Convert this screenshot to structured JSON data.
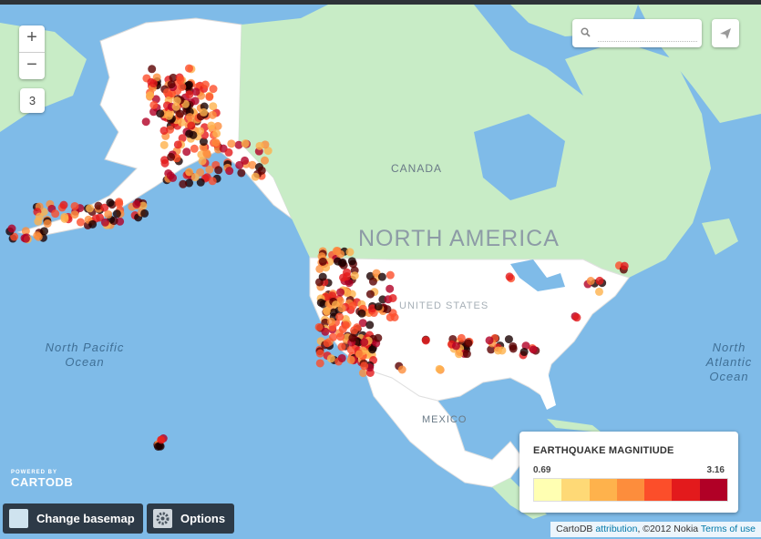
{
  "map": {
    "labels": {
      "canada": "CANADA",
      "north_america": "NORTH AMERICA",
      "united_states": "UNITED STATES",
      "mexico": "MEXICO",
      "north_pacific_ocean": "North Pacific Ocean",
      "north_atlantic": "North Atlantic Ocean"
    },
    "zoom_level": "3"
  },
  "controls": {
    "zoom_in": "+",
    "zoom_out": "−",
    "search_placeholder": "",
    "search_icon": "search-icon",
    "share_icon": "paper-plane-icon"
  },
  "legend": {
    "title": "EARTHQUAKE MAGNITIUDE",
    "min": "0.69",
    "max": "3.16",
    "colors": [
      "#ffffb2",
      "#fed976",
      "#feb24c",
      "#fd8d3c",
      "#fc4e2a",
      "#e31a1c",
      "#b10026"
    ]
  },
  "branding": {
    "powered_by": "POWERED BY",
    "name": "CARTODB"
  },
  "buttons": {
    "change_basemap": "Change basemap",
    "options": "Options"
  },
  "attribution": {
    "cartodb": "CartoDB",
    "attribution_link": "attribution",
    "copyright": ", ©2012 Nokia",
    "terms": "Terms of use"
  }
}
